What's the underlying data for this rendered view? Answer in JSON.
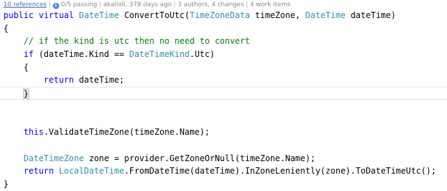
{
  "codelens": {
    "references": "10 references",
    "sep1": " | ",
    "tests": "0/5 passing",
    "sep2": " | ",
    "author": "akalloli, 378 days ago",
    "sep3": " | ",
    "authors": "3 authors, 4 changes",
    "sep4": " | ",
    "work_items": "4 work items"
  },
  "code": {
    "l1": {
      "kw1": "public",
      "kw2": "virtual",
      "type1": "DateTime",
      "method": "ConvertToUtc(",
      "type2": "TimeZoneData",
      "p1": " timeZone, ",
      "type3": "DateTime",
      "p2": " dateTime)"
    },
    "l2": {
      "text": "{"
    },
    "l3": {
      "indent": "    ",
      "comment": "// if the kind is utc then no need to convert"
    },
    "l4": {
      "indent": "    ",
      "kw": "if",
      "p1": " (dateTime.Kind == ",
      "type": "DateTimeKind",
      "p2": ".Utc)"
    },
    "l5": {
      "indent": "    ",
      "text": "{"
    },
    "l6": {
      "indent": "        ",
      "kw": "return",
      "p": " dateTime;"
    },
    "l7": {
      "indent": "    ",
      "text": "}"
    },
    "l8": {
      "text": ""
    },
    "l9": {
      "text": ""
    },
    "l10": {
      "indent": "    ",
      "kw": "this",
      "p": ".ValidateTimeZone(timeZone.Name);"
    },
    "l11": {
      "text": ""
    },
    "l12": {
      "indent": "    ",
      "type": "DateTimeZone",
      "p": " zone = provider.GetZoneOrNull(timeZone.Name);"
    },
    "l13": {
      "indent": "    ",
      "kw": "return",
      "type": "LocalDateTime",
      "p": ".FromDateTime(dateTime).InZoneLeniently(zone).ToDateTimeUtc();"
    },
    "l14": {
      "text": "}"
    }
  }
}
